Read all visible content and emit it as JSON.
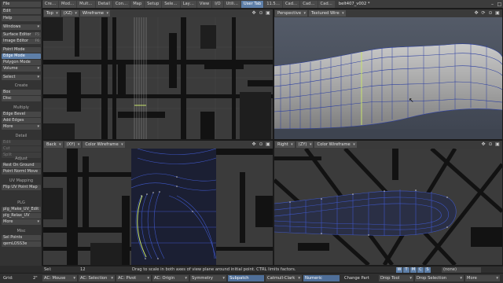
{
  "tabs": [
    "Cre…",
    "Mod…",
    "Mult…",
    "Detail",
    "Con…",
    "Map",
    "Setup",
    "Sele…",
    "Lay…",
    "View",
    "I/O",
    "Utili…",
    "User Tab",
    "11.5…",
    "Cad…",
    "Cad…",
    "Cad…"
  ],
  "active_tab": "User Tab",
  "window_title": "belt407_v002 *",
  "sidebar": {
    "file": "File",
    "edit": "Edit",
    "help": "Help",
    "windows": "Windows",
    "surface_editor": "Surface Editor",
    "surface_editor_key": "F5",
    "image_editor": "Image Editor",
    "image_editor_key": "F6",
    "point_mode": "Point Mode",
    "edge_mode": "Edge Mode",
    "polygon_mode": "Polygon Mode",
    "volume": "Volume",
    "select": "Select",
    "create_head": "Create",
    "box": "Box",
    "disc": "Disc",
    "multiply_head": "Multiply",
    "edge_bevel": "Edge Bevel",
    "add_edges": "Add Edges",
    "more_1": "More",
    "detail_head": "Detail",
    "dim_1": "Edit",
    "dim_2": "Cut",
    "dim_3": "Split",
    "adjust_head": "Adjust",
    "rest_on_ground": "Rest On Ground",
    "point_norml_move": "Point Norml Move",
    "uv_head": "UV Mapping",
    "flip_uv": "Flip UV Point Map",
    "plg_head": "PLG",
    "plg_make": "plg_Make_UV_Edit",
    "plg_relax": "plg_Relax_UV",
    "more_2": "More",
    "misc_head": "Misc",
    "sel_points": "Sel Points",
    "qem": "qemLOSS3e"
  },
  "viewports": {
    "top": {
      "view": "Top",
      "axes": "(XZ)",
      "mode": "Wireframe"
    },
    "persp": {
      "view": "Perspective",
      "mode": "Textured Wire"
    },
    "back": {
      "view": "Back",
      "axes": "(XY)",
      "mode": "Color Wireframe"
    },
    "right": {
      "view": "Right",
      "axes": "(ZY)",
      "mode": "Color Wireframe"
    }
  },
  "status": {
    "sel_label": "Sel:",
    "sel_count": "12",
    "hint": "Drag to scale in both axes of view plane around initial point. CTRL limits factors.",
    "toggles": [
      "W",
      "T",
      "M",
      "C",
      "S"
    ],
    "none": "(none)"
  },
  "bottom": {
    "grid_label": "Grid:",
    "grid_value": "2\"",
    "ac_mouse": "AC: Mouse",
    "ac_selection": "AC: Selection",
    "ac_pivot": "AC: Pivot",
    "ac_origin": "AC: Origin",
    "symmetry": "Symmetry",
    "subpatch": "Subpatch",
    "catmull": "Catmull-Clark",
    "numeric": "Numeric",
    "change_part": "Change Part",
    "drop_tool": "Drop Tool",
    "drop_selection": "Drop Selection",
    "more": "More"
  },
  "colors": {
    "accent": "#5e7fa8",
    "wire": "#3f57c7",
    "highlight": "#c7e36b"
  }
}
